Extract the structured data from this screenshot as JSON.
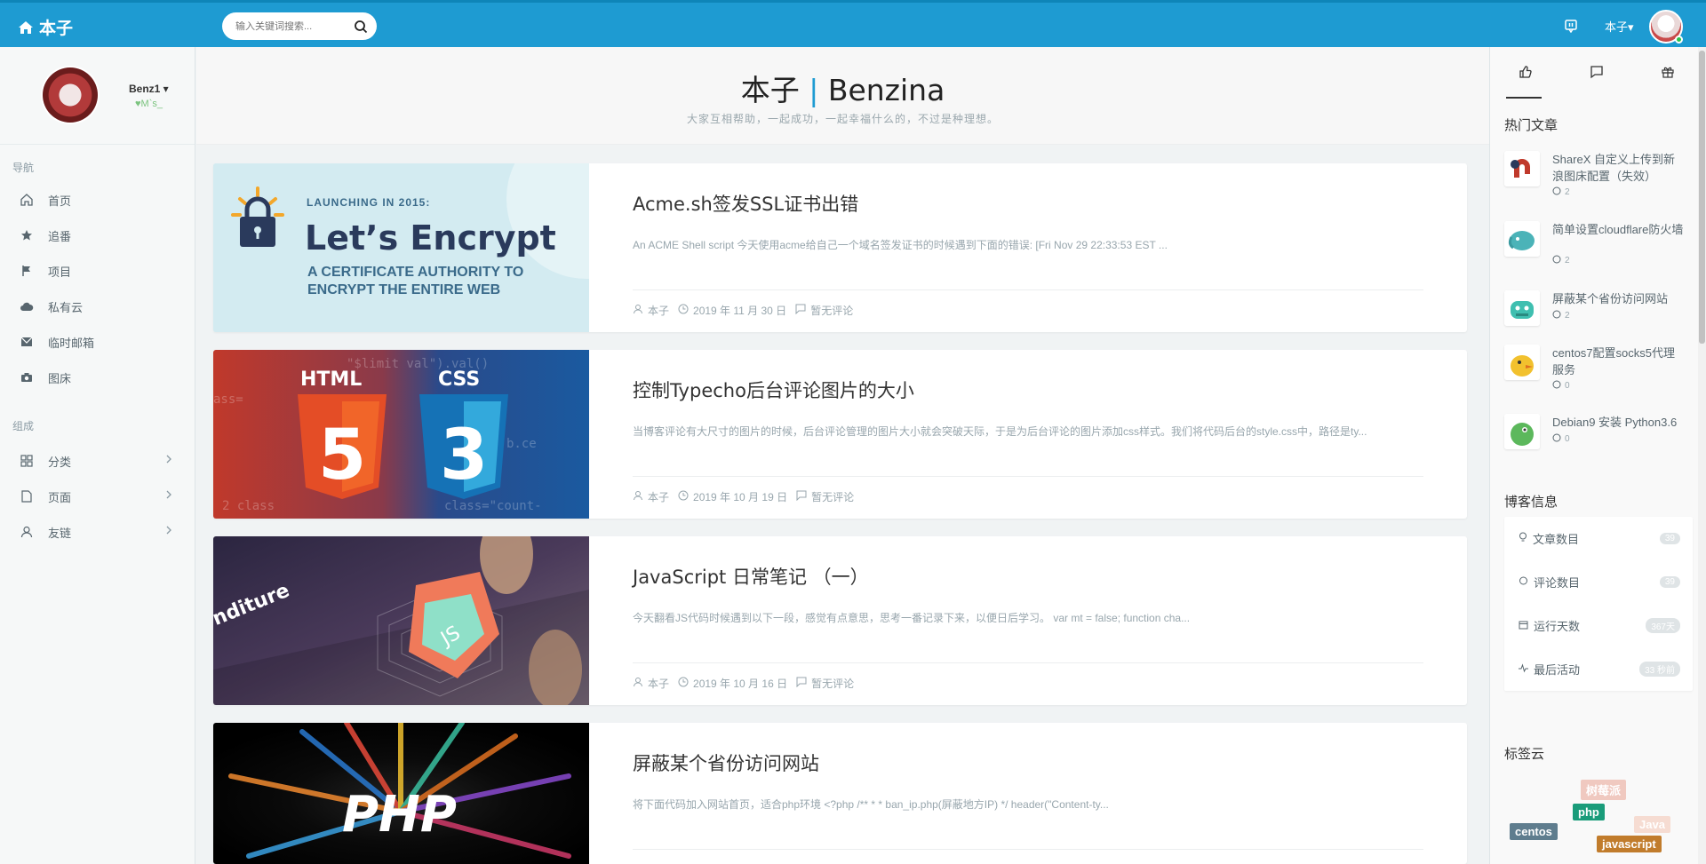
{
  "header": {
    "brand": "本子",
    "search_placeholder": "输入关键词搜索...",
    "user": "本子▾"
  },
  "sidebar": {
    "profile_name": "Benz1 ▾",
    "profile_sub": "♥M`s_",
    "group_nav": "导航",
    "group_misc": "组成",
    "items": [
      {
        "label": "首页",
        "icon": "home-icon"
      },
      {
        "label": "追番",
        "icon": "star-icon"
      },
      {
        "label": "项目",
        "icon": "flag-icon"
      },
      {
        "label": "私有云",
        "icon": "cloud-icon"
      },
      {
        "label": "临时邮箱",
        "icon": "mail-icon"
      },
      {
        "label": "图床",
        "icon": "camera-icon"
      }
    ],
    "items2": [
      {
        "label": "分类",
        "icon": "grid-icon"
      },
      {
        "label": "页面",
        "icon": "file-icon"
      },
      {
        "label": "友链",
        "icon": "user-icon"
      }
    ]
  },
  "site": {
    "title_cn": "本子",
    "title_sep": "|",
    "title_en": "Benzina",
    "subtitle": "大家互相帮助，一起成功，一起幸福什么的，不过是种理想。"
  },
  "posts": [
    {
      "title": "Acme.sh签发SSL证书出错",
      "excerpt": "An ACME Shell script 今天使用acme给自己一个域名签发证书的时候遇到下面的错误: [Fri Nov 29 22:33:53 EST ...",
      "author": "本子",
      "date": "2019 年 11 月 30 日",
      "comments": "暂无评论",
      "thumb": {
        "launch": "LAUNCHING IN 2015:",
        "name": "Let’s Encrypt",
        "line1": "A CERTIFICATE AUTHORITY TO",
        "line2": "ENCRYPT THE ENTIRE WEB"
      }
    },
    {
      "title": "控制Typecho后台评论图片的大小",
      "excerpt": "当博客评论有大尺寸的图片的时候，后台评论管理的图片大小就会突破天际，于是为后台评论的图片添加css样式。我们将代码后台的style.css中，路径是ty...",
      "author": "本子",
      "date": "2019 年 10 月 19 日",
      "comments": "暂无评论",
      "thumb": {
        "html": "HTML",
        "css": "CSS",
        "five": "5",
        "three": "3"
      }
    },
    {
      "title": "JavaScript 日常笔记 （一）",
      "excerpt": "今天翻看JS代码时候遇到以下一段，感觉有点意思，思考一番记录下来，以便日后学习。 var mt = false; function cha...",
      "author": "本子",
      "date": "2019 年 10 月 16 日",
      "comments": "暂无评论",
      "thumb": {
        "word": "nditure",
        "js": "JS"
      }
    },
    {
      "title": "屏蔽某个省份访问网站",
      "excerpt": "将下面代码加入网站首页，适合php环境 <?php /** * * ban_ip.php(屏蔽地方IP) */ header(\"Content-ty...",
      "thumb": {
        "php": "PHP"
      }
    }
  ],
  "right": {
    "hot_title": "热门文章",
    "hot": [
      {
        "title": "ShareX 自定义上传到新浪图床配置（失效）",
        "count": "2",
        "color": "#c0392b"
      },
      {
        "title": "简单设置cloudflare防火墙",
        "count": "2",
        "color": "#4bb3b8"
      },
      {
        "title": "屏蔽某个省份访问网站",
        "count": "2",
        "color": "#3fbfb0"
      },
      {
        "title": "centos7配置socks5代理服务",
        "count": "0",
        "color": "#f2c12e"
      },
      {
        "title": "Debian9 安装 Python3.6",
        "count": "0",
        "color": "#5cb85c"
      }
    ],
    "info_title": "博客信息",
    "info": [
      {
        "label": "文章数目",
        "value": "39"
      },
      {
        "label": "评论数目",
        "value": "39"
      },
      {
        "label": "运行天数",
        "value": "367天"
      },
      {
        "label": "最后活动",
        "value": "33 秒前"
      }
    ],
    "tags_title": "标签云",
    "tags": [
      {
        "label": "树莓派",
        "color": "#f0c9c0"
      },
      {
        "label": "php",
        "color": "#1a9c7a"
      },
      {
        "label": "Java",
        "color": "#f6dcd2"
      },
      {
        "label": "centos",
        "color": "#5f7d8e"
      },
      {
        "label": "javascript",
        "color": "#c17c2c"
      }
    ]
  },
  "colors": {
    "accent": "#1e9bd2"
  }
}
